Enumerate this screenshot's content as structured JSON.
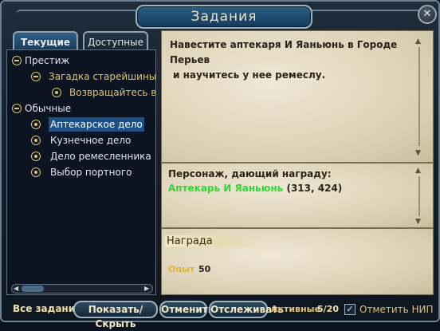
{
  "window": {
    "title": "Задания"
  },
  "tabs": {
    "current": "Текущие",
    "available": "Доступные"
  },
  "quest_list": {
    "groups": [
      {
        "label": "Престиж",
        "children": [
          {
            "label": "Загадка старейшины",
            "children": [
              {
                "label": "Возвращайтесь в Пе"
              }
            ]
          }
        ]
      },
      {
        "label": "Обычные",
        "children": [
          {
            "label": "Аптекарское дело"
          },
          {
            "label": "Кузнечное дело"
          },
          {
            "label": "Дело ремесленника"
          },
          {
            "label": "Выбор портного"
          }
        ]
      }
    ]
  },
  "quest_detail": {
    "description_line1": "Навестите аптекаря И Яаньюнь в Городе Перьев",
    "description_line2": "и научитесь у нее ремеслу.",
    "giver_label": "Персонаж, дающий награду:",
    "giver_name": "Аптекарь И Яаньюнь",
    "giver_coords": "(313, 424)",
    "reward_header": "Награда",
    "exp_label": "Опыт",
    "exp_value": "50"
  },
  "bottom_bar": {
    "all_quests_label": "Все задания:",
    "show_hide_button": "Показать/Скрыть",
    "cancel_button": "Отменить",
    "track_button": "Отслеживать",
    "active_label": "Активные",
    "active_count": "5/20",
    "mark_npc_label": "Отметить НИП",
    "mark_npc_checked": true
  },
  "colors": {
    "giver_name": "#33d633",
    "selected_row": "#1e4f86",
    "parchment": "#e6dcc2",
    "gold_text": "#e0c470"
  },
  "icons": [
    "close-icon",
    "collapse-icon",
    "bullet-icon",
    "scroll-up-icon",
    "scroll-down-icon",
    "checkbox-check-icon"
  ]
}
